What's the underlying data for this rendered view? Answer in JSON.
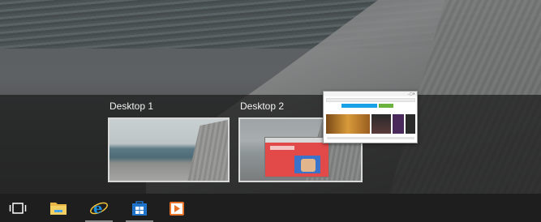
{
  "desktops": [
    {
      "label": "Desktop 1"
    },
    {
      "label": "Desktop 2"
    }
  ],
  "taskbar": {
    "items": [
      {
        "icon": "task-view-icon",
        "running": false
      },
      {
        "icon": "file-explorer-icon",
        "running": false
      },
      {
        "icon": "internet-explorer-icon",
        "running": true
      },
      {
        "icon": "store-icon",
        "running": true
      },
      {
        "icon": "media-player-icon",
        "running": false
      }
    ]
  },
  "colors": {
    "taskbar": "#1e1e1e",
    "thumb_border": "#d8d8d8",
    "ie_blue": "#1b8fe0",
    "store_blue": "#1f74c9",
    "media_orange": "#e8742a"
  }
}
